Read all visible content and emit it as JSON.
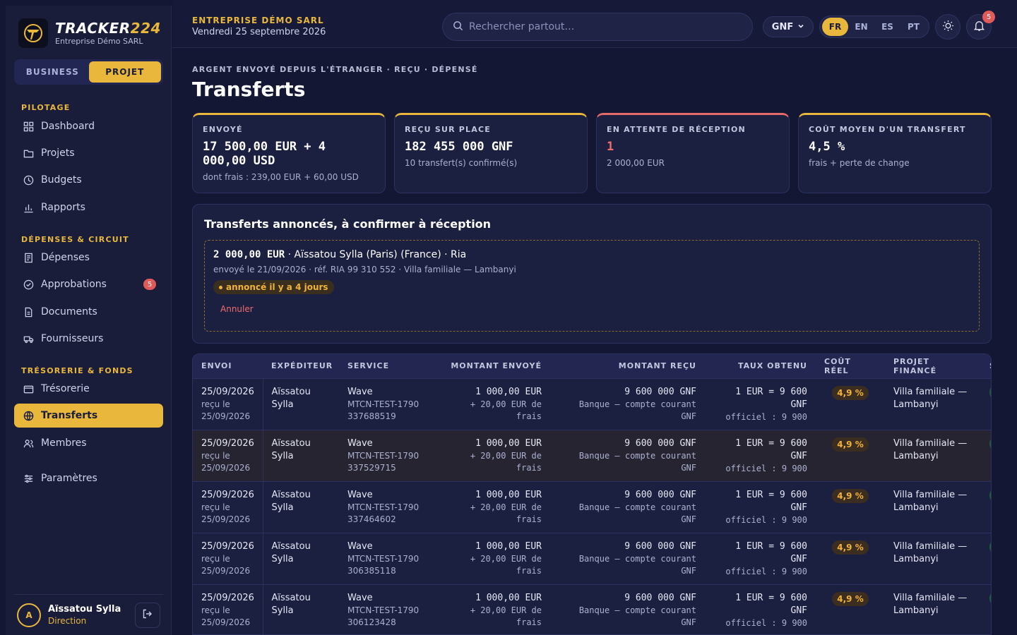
{
  "brand": {
    "name_a": "TRACKER",
    "name_b": "224",
    "subtitle": "Entreprise Démo SARL"
  },
  "mode": {
    "business": "BUSINESS",
    "project": "PROJET",
    "active": "project"
  },
  "nav": {
    "section_pilotage": "PILOTAGE",
    "dashboard": "Dashboard",
    "projets": "Projets",
    "budgets": "Budgets",
    "rapports": "Rapports",
    "section_depenses": "DÉPENSES & CIRCUIT",
    "depenses": "Dépenses",
    "approbations": "Approbations",
    "approbations_badge": "5",
    "documents": "Documents",
    "fournisseurs": "Fournisseurs",
    "section_tresorerie": "TRÉSORERIE & FONDS",
    "tresorerie": "Trésorerie",
    "transferts": "Transferts",
    "membres": "Membres",
    "parametres": "Paramètres"
  },
  "user": {
    "initial": "A",
    "name": "Aïssatou Sylla",
    "role": "Direction"
  },
  "header": {
    "company": "ENTREPRISE DÉMO SARL",
    "date": "Vendredi 25 septembre 2026",
    "search_placeholder": "Rechercher partout…",
    "currency": "GNF",
    "langs": [
      "FR",
      "EN",
      "ES",
      "PT"
    ],
    "active_lang": "FR",
    "notif_count": "5"
  },
  "page": {
    "eyebrow": "ARGENT ENVOYÉ DEPUIS L'ÉTRANGER · REÇU · DÉPENSÉ",
    "title": "Transferts"
  },
  "stats": [
    {
      "label": "ENVOYÉ",
      "value": "17 500,00 EUR + 4 000,00 USD",
      "sub": "dont frais : 239,00 EUR + 60,00 USD"
    },
    {
      "label": "REÇU SUR PLACE",
      "value": "182 455 000 GNF",
      "sub": "10 transfert(s) confirmé(s)"
    },
    {
      "label": "EN ATTENTE DE RÉCEPTION",
      "value": "1",
      "sub": "2 000,00 EUR"
    },
    {
      "label": "COÛT MOYEN D'UN TRANSFERT",
      "value": "4,5 %",
      "sub": "frais + perte de change"
    }
  ],
  "pending": {
    "title": "Transferts annoncés, à confirmer à réception",
    "amount": "2 000,00 EUR",
    "details": " · Aïssatou Sylla (Paris) (France) · Ria",
    "meta": "envoyé le 21/09/2026 · réf. RIA 99 310 552 · Villa familiale — Lambanyi",
    "badge": "annoncé il y a 4 jours",
    "cancel": "Annuler"
  },
  "table": {
    "headers": [
      "ENVOI",
      "EXPÉDITEUR",
      "SERVICE",
      "MONTANT ENVOYÉ",
      "MONTANT REÇU",
      "TAUX OBTENU",
      "COÛT RÉEL",
      "PROJET FINANCÉ",
      "S"
    ],
    "rows": [
      {
        "date": "25/09/2026",
        "recu": "reçu le",
        "recu_date": "25/09/2026",
        "sender": "Aïssatou Sylla",
        "service": "Wave",
        "ref": "MTCN-TEST-1790337688519",
        "sent": "1 000,00 EUR",
        "fees": "+ 20,00 EUR de frais",
        "received": "9 600 000 GNF",
        "account": "Banque — compte courant GNF",
        "rate": "1 EUR = 9 600 GNF",
        "official": "officiel : 9 900",
        "cost": "4,9 %",
        "project": "Villa familiale — Lambanyi"
      },
      {
        "date": "25/09/2026",
        "recu": "reçu le",
        "recu_date": "25/09/2026",
        "sender": "Aïssatou Sylla",
        "service": "Wave",
        "ref": "MTCN-TEST-1790337529715",
        "sent": "1 000,00 EUR",
        "fees": "+ 20,00 EUR de frais",
        "received": "9 600 000 GNF",
        "account": "Banque — compte courant GNF",
        "rate": "1 EUR = 9 600 GNF",
        "official": "officiel : 9 900",
        "cost": "4,9 %",
        "project": "Villa familiale — Lambanyi"
      },
      {
        "date": "25/09/2026",
        "recu": "reçu le",
        "recu_date": "25/09/2026",
        "sender": "Aïssatou Sylla",
        "service": "Wave",
        "ref": "MTCN-TEST-1790337464602",
        "sent": "1 000,00 EUR",
        "fees": "+ 20,00 EUR de frais",
        "received": "9 600 000 GNF",
        "account": "Banque — compte courant GNF",
        "rate": "1 EUR = 9 600 GNF",
        "official": "officiel : 9 900",
        "cost": "4,9 %",
        "project": "Villa familiale — Lambanyi"
      },
      {
        "date": "25/09/2026",
        "recu": "reçu le",
        "recu_date": "25/09/2026",
        "sender": "Aïssatou Sylla",
        "service": "Wave",
        "ref": "MTCN-TEST-1790306385118",
        "sent": "1 000,00 EUR",
        "fees": "+ 20,00 EUR de frais",
        "received": "9 600 000 GNF",
        "account": "Banque — compte courant GNF",
        "rate": "1 EUR = 9 600 GNF",
        "official": "officiel : 9 900",
        "cost": "4,9 %",
        "project": "Villa familiale — Lambanyi"
      },
      {
        "date": "25/09/2026",
        "recu": "reçu le",
        "recu_date": "25/09/2026",
        "sender": "Aïssatou Sylla",
        "service": "Wave",
        "ref": "MTCN-TEST-1790306123428",
        "sent": "1 000,00 EUR",
        "fees": "+ 20,00 EUR de frais",
        "received": "9 600 000 GNF",
        "account": "Banque — compte courant GNF",
        "rate": "1 EUR = 9 600 GNF",
        "official": "officiel : 9 900",
        "cost": "4,9 %",
        "project": "Villa familiale — Lambanyi"
      }
    ]
  },
  "colors": {
    "accent": "#e8b73c",
    "danger": "#e05a5a",
    "background": "#141733",
    "panel": "#1b1f40"
  },
  "icons": [
    "logo-icon",
    "dashboard-icon",
    "folder-icon",
    "budget-icon",
    "chart-icon",
    "receipt-icon",
    "check-icon",
    "document-icon",
    "truck-icon",
    "wallet-icon",
    "globe-icon",
    "users-icon",
    "sliders-icon",
    "logout-icon",
    "search-icon",
    "chevron-down-icon",
    "sun-icon",
    "bell-icon"
  ]
}
